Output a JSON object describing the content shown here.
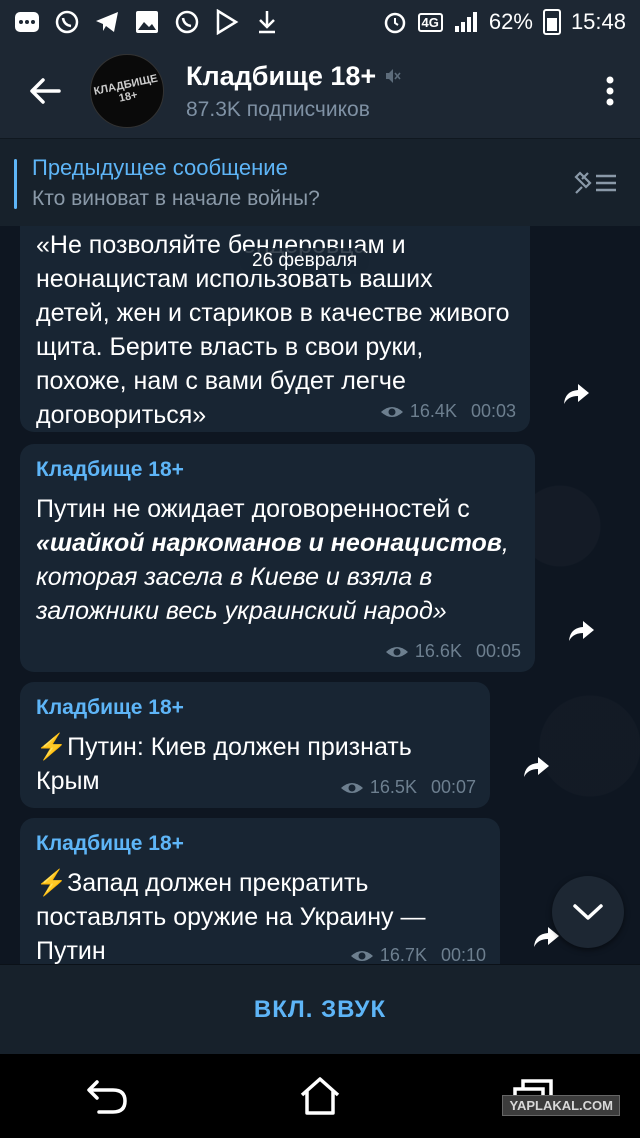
{
  "status_bar": {
    "network": "4G",
    "battery": "62%",
    "time": "15:48"
  },
  "header": {
    "channel_title": "Кладбище 18+",
    "subscribers": "87.3K подписчиков",
    "avatar_text": "КЛАДБИЩЕ 18+"
  },
  "pinned": {
    "title": "Предыдущее сообщение",
    "subtitle": "Кто виноват в начале войны?"
  },
  "date_chip": "26 февраля",
  "messages": [
    {
      "author": "",
      "text": "«Не позволяйте бендеровцам и неонацистам использовать ваших детей, жен и стариков в качестве живого щита. Берите власть в свои руки, похоже, нам с вами будет легче договориться»",
      "views": "16.4K",
      "time": "00:03"
    },
    {
      "author": "Кладбище 18+",
      "text_plain": "Путин не ожидает договоренностей с ",
      "text_bold_italic": "«шайкой наркоманов и неонацистов",
      "text_italic": ", которая засела в Киеве и взяла в заложники весь украинский народ»",
      "views": "16.6K",
      "time": "00:05"
    },
    {
      "author": "Кладбище 18+",
      "text": "⚡Путин: Киев должен признать Крым",
      "views": "16.5K",
      "time": "00:07"
    },
    {
      "author": "Кладбище 18+",
      "text": "⚡Запад должен прекратить поставлять оружие на Украину — Путин",
      "views": "16.7K",
      "time": "00:10"
    }
  ],
  "bottom": {
    "unmute_label": "ВКЛ. ЗВУК"
  },
  "watermark": "YAPLAKAL.COM",
  "colors": {
    "accent": "#5eb5f7",
    "background": "#0e1621",
    "bubble": "#182533",
    "header": "#1d2733"
  }
}
